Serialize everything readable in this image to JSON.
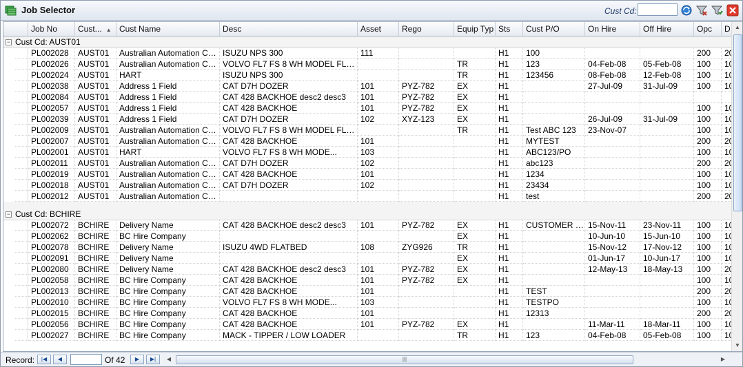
{
  "window": {
    "title": "Job Selector"
  },
  "toolbar": {
    "cust_label": "Cust Cd:",
    "cust_value": ""
  },
  "columns": [
    {
      "key": "job",
      "label": "Job No",
      "sort": ""
    },
    {
      "key": "cust",
      "label": "Cust...",
      "sort": "asc"
    },
    {
      "key": "name",
      "label": "Cust Name",
      "sort": ""
    },
    {
      "key": "desc",
      "label": "Desc",
      "sort": ""
    },
    {
      "key": "asset",
      "label": "Asset",
      "sort": ""
    },
    {
      "key": "rego",
      "label": "Rego",
      "sort": ""
    },
    {
      "key": "equip",
      "label": "Equip Typ",
      "sort": ""
    },
    {
      "key": "sts",
      "label": "Sts",
      "sort": ""
    },
    {
      "key": "po",
      "label": "Cust P/O",
      "sort": ""
    },
    {
      "key": "onhire",
      "label": "On Hire",
      "sort": ""
    },
    {
      "key": "offhire",
      "label": "Off Hire",
      "sort": ""
    },
    {
      "key": "opc",
      "label": "Opc",
      "sort": ""
    },
    {
      "key": "d",
      "label": "D",
      "sort": ""
    }
  ],
  "groups": [
    {
      "label": "Cust Cd: AUST01",
      "rows": [
        [
          "PL002028",
          "AUST01",
          "Australian Automation Cen...",
          "ISUZU NPS 300",
          "111",
          "",
          "",
          "H1",
          "100",
          "",
          "",
          "200",
          "20"
        ],
        [
          "PL002026",
          "AUST01",
          "Australian Automation Cen...",
          "VOLVO FL7 FS 8 WH MODEL FL7F...",
          "",
          "",
          "TR",
          "H1",
          "123",
          "04-Feb-08",
          "05-Feb-08",
          "100",
          "10"
        ],
        [
          "PL002024",
          "AUST01",
          "HART",
          "ISUZU NPS 300",
          "",
          "",
          "TR",
          "H1",
          "123456",
          "08-Feb-08",
          "12-Feb-08",
          "100",
          "10"
        ],
        [
          "PL002038",
          "AUST01",
          "Address 1 Field",
          "CAT D7H DOZER",
          "101",
          "PYZ-782",
          "EX",
          "H1",
          "",
          "27-Jul-09",
          "31-Jul-09",
          "100",
          "10"
        ],
        [
          "PL002084",
          "AUST01",
          "Address 1 Field",
          "CAT 428 BACKHOE desc2 desc3",
          "101",
          "PYZ-782",
          "EX",
          "H1",
          "",
          "",
          "",
          "",
          ""
        ],
        [
          "PL002057",
          "AUST01",
          "Address 1 Field",
          "CAT 428 BACKHOE",
          "101",
          "PYZ-782",
          "EX",
          "H1",
          "",
          "",
          "",
          "100",
          "10"
        ],
        [
          "PL002039",
          "AUST01",
          "Address 1 Field",
          "CAT D7H DOZER",
          "102",
          "XYZ-123",
          "EX",
          "H1",
          "",
          "26-Jul-09",
          "31-Jul-09",
          "100",
          "10"
        ],
        [
          "PL002009",
          "AUST01",
          "Australian Automation Cen...",
          "VOLVO FL7 FS 8 WH MODEL FL7F...",
          "",
          "",
          "TR",
          "H1",
          "Test ABC 123",
          "23-Nov-07",
          "",
          "100",
          "10"
        ],
        [
          "PL002007",
          "AUST01",
          "Australian Automation Cen...",
          "CAT 428 BACKHOE",
          "101",
          "",
          "",
          "H1",
          "MYTEST",
          "",
          "",
          "200",
          "20"
        ],
        [
          "PL002001",
          "AUST01",
          "HART",
          "VOLVO FL7 FS 8 WH                MODE...",
          "103",
          "",
          "",
          "H1",
          "ABC123/PO",
          "",
          "",
          "100",
          "10"
        ],
        [
          "PL002011",
          "AUST01",
          "Australian Automation Cen...",
          "CAT D7H DOZER",
          "102",
          "",
          "",
          "H1",
          "abc123",
          "",
          "",
          "200",
          "20"
        ],
        [
          "PL002019",
          "AUST01",
          "Australian Automation Cen...",
          "CAT 428 BACKHOE",
          "101",
          "",
          "",
          "H1",
          "1234",
          "",
          "",
          "100",
          "10"
        ],
        [
          "PL002018",
          "AUST01",
          "Australian Automation Cen...",
          "CAT D7H DOZER",
          "102",
          "",
          "",
          "H1",
          "23434",
          "",
          "",
          "100",
          "10"
        ],
        [
          "PL002012",
          "AUST01",
          "Australian Automation Cen...",
          "",
          "",
          "",
          "",
          "H1",
          "test",
          "",
          "",
          "200",
          "20"
        ]
      ]
    },
    {
      "label": "Cust Cd: BCHIRE",
      "rows": [
        [
          "PL002072",
          "BCHIRE",
          "Delivery Name",
          "CAT 428 BACKHOE desc2 desc3",
          "101",
          "PYZ-782",
          "EX",
          "H1",
          "CUSTOMER P...",
          "15-Nov-11",
          "23-Nov-11",
          "100",
          "10"
        ],
        [
          "PL002062",
          "BCHIRE",
          "BC Hire Company",
          "",
          "",
          "",
          "EX",
          "H1",
          "",
          "10-Jun-10",
          "15-Jun-10",
          "100",
          "10"
        ],
        [
          "PL002078",
          "BCHIRE",
          "Delivery Name",
          "ISUZU 4WD FLATBED",
          "108",
          "ZYG926",
          "TR",
          "H1",
          "",
          "15-Nov-12",
          "17-Nov-12",
          "100",
          "10"
        ],
        [
          "PL002091",
          "BCHIRE",
          "Delivery Name",
          "",
          "",
          "",
          "EX",
          "H1",
          "",
          "01-Jun-17",
          "10-Jun-17",
          "100",
          "10"
        ],
        [
          "PL002080",
          "BCHIRE",
          "Delivery Name",
          "CAT 428 BACKHOE desc2 desc3",
          "101",
          "PYZ-782",
          "EX",
          "H1",
          "",
          "12-May-13",
          "18-May-13",
          "100",
          "20"
        ],
        [
          "PL002058",
          "BCHIRE",
          "BC Hire Company",
          "CAT 428 BACKHOE",
          "101",
          "PYZ-782",
          "EX",
          "H1",
          "",
          "",
          "",
          "100",
          "10"
        ],
        [
          "PL002013",
          "BCHIRE",
          "BC Hire Company",
          "CAT 428 BACKHOE",
          "101",
          "",
          "",
          "H1",
          "TEST",
          "",
          "",
          "200",
          "20"
        ],
        [
          "PL002010",
          "BCHIRE",
          "BC Hire Company",
          "VOLVO FL7 FS 8 WH                MODE...",
          "103",
          "",
          "",
          "H1",
          "TESTPO",
          "",
          "",
          "100",
          "10"
        ],
        [
          "PL002015",
          "BCHIRE",
          "BC Hire Company",
          "CAT 428 BACKHOE",
          "101",
          "",
          "",
          "H1",
          "12313",
          "",
          "",
          "200",
          "20"
        ],
        [
          "PL002056",
          "BCHIRE",
          "BC Hire Company",
          "CAT 428 BACKHOE",
          "101",
          "PYZ-782",
          "EX",
          "H1",
          "",
          "11-Mar-11",
          "18-Mar-11",
          "100",
          "10"
        ],
        [
          "PL002027",
          "BCHIRE",
          "BC Hire Company",
          "MACK - TIPPER / LOW LOADER",
          "",
          "",
          "TR",
          "H1",
          "123",
          "04-Feb-08",
          "05-Feb-08",
          "100",
          "10"
        ]
      ]
    }
  ],
  "footer": {
    "record_label": "Record:",
    "record_value": "",
    "of_label": "Of",
    "total": "42"
  },
  "icons": {
    "app": "grid-stack-icon",
    "refresh": "refresh-icon",
    "filter_clear": "filter-clear-icon",
    "filter": "filter-icon",
    "close": "close-icon"
  },
  "colors": {
    "close": "#e0392b",
    "accent": "#1b4a91",
    "app_icon": "#3aa54a"
  }
}
